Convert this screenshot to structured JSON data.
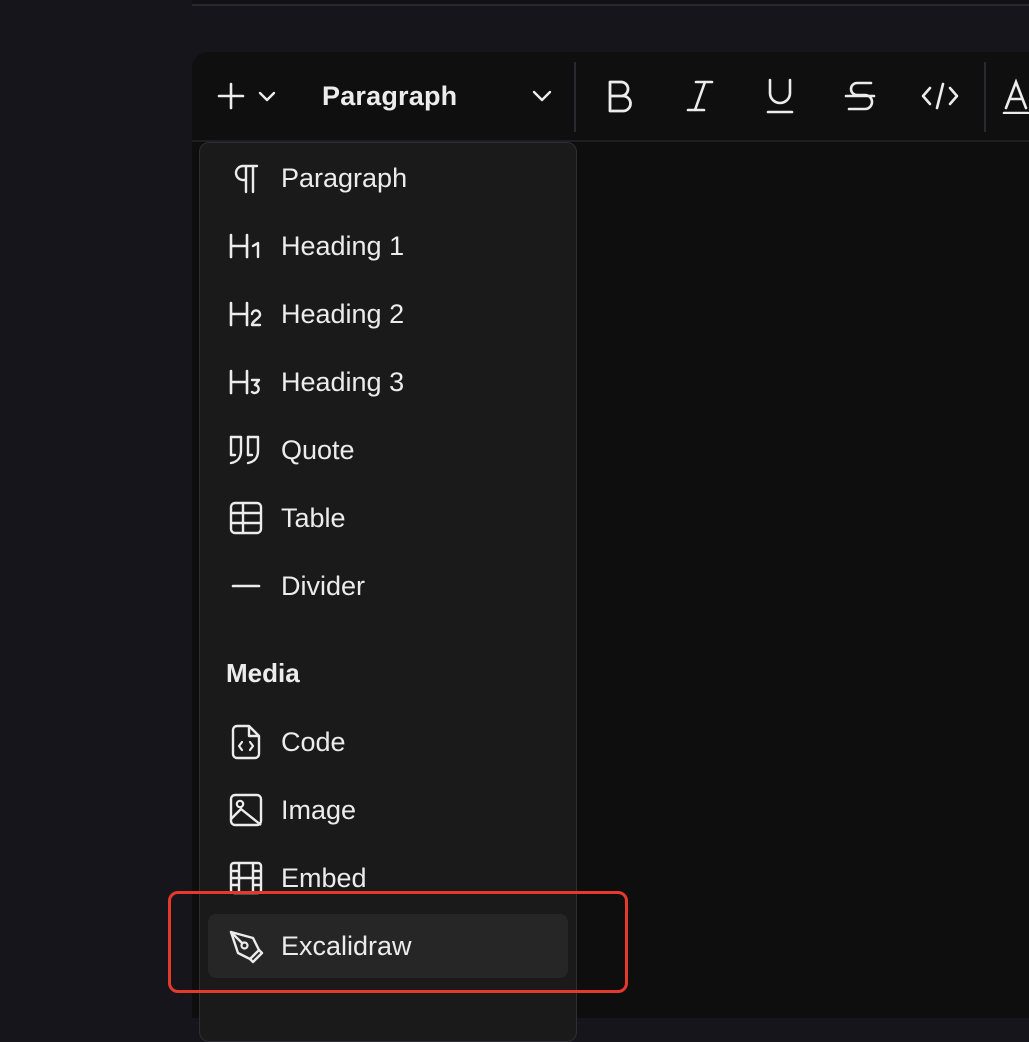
{
  "toolbar": {
    "block_type": "Paragraph",
    "buttons": [
      "plus-icon",
      "bold-icon",
      "italic-icon",
      "underline-icon",
      "strikethrough-icon",
      "code-icon"
    ]
  },
  "menu": {
    "items": [
      {
        "label": "Paragraph",
        "icon": "pilcrow-icon"
      },
      {
        "label": "Heading 1",
        "icon": "heading-1-icon"
      },
      {
        "label": "Heading 2",
        "icon": "heading-2-icon"
      },
      {
        "label": "Heading 3",
        "icon": "heading-3-icon"
      },
      {
        "label": "Quote",
        "icon": "quote-icon"
      },
      {
        "label": "Table",
        "icon": "table-icon"
      },
      {
        "label": "Divider",
        "icon": "divider-icon"
      }
    ],
    "media_section": {
      "title": "Media",
      "items": [
        {
          "label": "Code",
          "icon": "code-file-icon"
        },
        {
          "label": "Image",
          "icon": "image-icon"
        },
        {
          "label": "Embed",
          "icon": "film-icon"
        },
        {
          "label": "Excalidraw",
          "icon": "pen-tool-icon"
        }
      ]
    }
  },
  "colors": {
    "highlight": "#e53a2b",
    "menu_bg": "#1a1a1b",
    "active_item_bg": "#262627"
  }
}
